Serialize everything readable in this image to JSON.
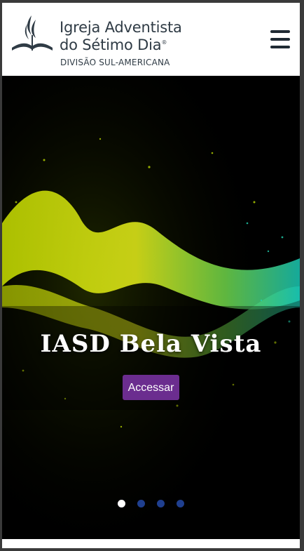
{
  "header": {
    "brand_line1": "Igreja Adventista",
    "brand_line2": "do Sétimo Dia",
    "registered_mark": "®",
    "brand_sub": "DIVISÃO SUL-AMERICANA",
    "logo_icon": "adventist-flame-book-logo",
    "menu_icon": "hamburger-menu-icon"
  },
  "carousel": {
    "current_slide": 1,
    "slide_count": 4,
    "slide": {
      "title": "IASD Bela Vista",
      "button_label": "Accessar"
    },
    "colors": {
      "button": "#6b2d8f",
      "dot_active": "#ffffff",
      "dot_inactive": "#1f3f8f"
    }
  }
}
